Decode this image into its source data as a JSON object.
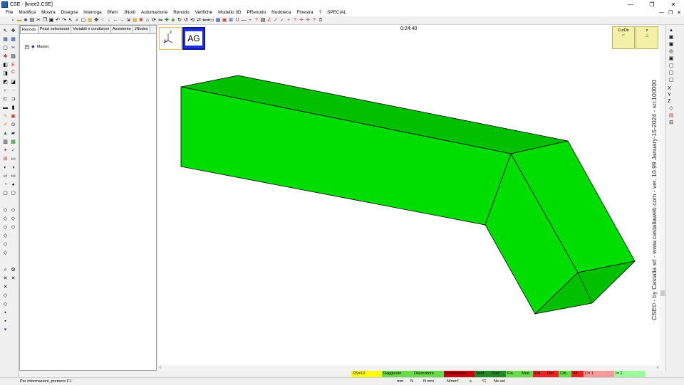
{
  "window": {
    "title": "CSE - [knee2.CSE]",
    "minimize": "—",
    "maximize": "❐",
    "close": "✕"
  },
  "menu": [
    "File",
    "Modifica",
    "Mostra",
    "Disegna",
    "Interroga",
    "Bfem",
    "JNodi",
    "Automazione",
    "Renodo",
    "Verifiche",
    "Modello 3D",
    "PRenodo",
    "Nodoteca",
    "Finestra",
    "?",
    "SPECIAL"
  ],
  "mdi_controls": {
    "minimize": "—",
    "restore": "❐",
    "close": "✕"
  },
  "panel": {
    "tabs": [
      "Renodo",
      "Pezzi selezionati",
      "Variabili e condizioni",
      "Assistente",
      "JNodes"
    ],
    "tree_toggle": "+",
    "tree_root": "Master"
  },
  "viewport": {
    "timer": "0:24:40",
    "axis_z": "z",
    "axis_y": "y",
    "ag_label": "AG",
    "curdir_label": "CurDir",
    "z_box_label": "z",
    "watermark": "CSE© - by Castalia srl - www.castaliaweb.com - ver. 10.99 January-15-2024 - sn:100000",
    "model_color": "#00dd00",
    "model_color_dark": "#00c000"
  },
  "right_toolbar": {
    "letters": [
      "X",
      "Y",
      "Z"
    ]
  },
  "status_indicators": [
    {
      "label": "DS=10",
      "bg": "#ffff00"
    },
    {
      "label": "Raggiusto",
      "bg": "#66dd44"
    },
    {
      "label": "Dislocatore",
      "bg": "#66dd44"
    },
    {
      "label": "Intersezione",
      "bg": "#cc0000"
    },
    {
      "label": "Verif.",
      "bg": "#228822"
    },
    {
      "label": "Corr.",
      "bg": "#228822"
    },
    {
      "label": "Fin.",
      "bg": "#66dd44"
    },
    {
      "label": "Med.",
      "bg": "#66dd44"
    },
    {
      "label": "Ext.",
      "bg": "#ee2222"
    },
    {
      "label": "Out",
      "bg": "#ee2222"
    },
    {
      "label": "Crit.",
      "bg": "#66dd44"
    },
    {
      "label": "Alt.",
      "bg": "#ee2222"
    },
    {
      "label": "C= 1",
      "bg": "#ff9999"
    },
    {
      "label": "I= 1",
      "bg": "#99ff99"
    }
  ],
  "status_info": "Per informazioni, premere F1",
  "units": [
    "mm",
    "N",
    "N mm",
    "N/mm²",
    "s",
    "°C",
    "No sel"
  ]
}
